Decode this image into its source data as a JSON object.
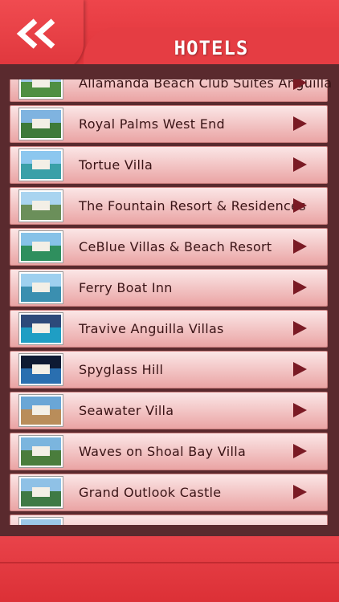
{
  "header": {
    "title": "HOTELS",
    "back_icon": "double-chevron-left-icon"
  },
  "hotels": [
    {
      "name": "Allamanda Beach Club Suites Anguilla",
      "thumb": [
        "#9fc9e8",
        "#4f8f42"
      ]
    },
    {
      "name": "Royal Palms West End",
      "thumb": [
        "#7fb3e0",
        "#3e7a3a"
      ]
    },
    {
      "name": "Tortue Villa",
      "thumb": [
        "#8cc7ef",
        "#3aa0a8"
      ]
    },
    {
      "name": "The Fountain Resort & Residences",
      "thumb": [
        "#a9d4f0",
        "#6b8f5a"
      ]
    },
    {
      "name": "CeBlue Villas & Beach Resort",
      "thumb": [
        "#86c2e8",
        "#2f8f5e"
      ]
    },
    {
      "name": "Ferry Boat Inn",
      "thumb": [
        "#9ed0ef",
        "#3b8fb0"
      ]
    },
    {
      "name": "Travive Anguilla Villas",
      "thumb": [
        "#2d4a7a",
        "#1f9ec4"
      ]
    },
    {
      "name": "Spyglass Hill",
      "thumb": [
        "#0e1a33",
        "#2a6fb0"
      ]
    },
    {
      "name": "Seawater Villa",
      "thumb": [
        "#6aa6d6",
        "#b98d5a"
      ]
    },
    {
      "name": "Waves on Shoal Bay Villa",
      "thumb": [
        "#7bb5de",
        "#4a7d3c"
      ]
    },
    {
      "name": "Grand Outlook Castle",
      "thumb": [
        "#8fc1e6",
        "#3f7a45"
      ]
    },
    {
      "name": "",
      "thumb": [
        "#9cc8e8",
        "#8a6a4a"
      ]
    }
  ],
  "row_arrow_icon": "play-arrow-icon"
}
